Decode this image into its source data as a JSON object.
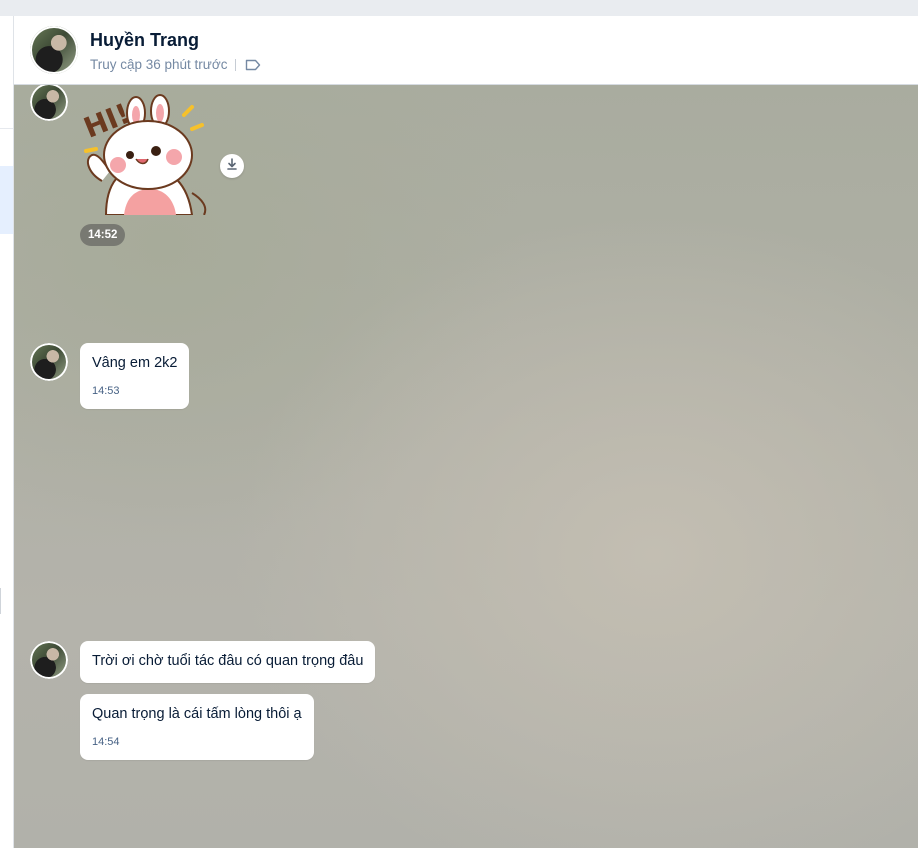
{
  "contact": {
    "name": "Huyền Trang",
    "status": "Truy cập 36 phút trước"
  },
  "messages": [
    {
      "type": "sticker",
      "alt": "HI!",
      "time": "14:52"
    },
    {
      "type": "text",
      "text": "Vâng em 2k2",
      "time": "14:53"
    },
    {
      "type": "text",
      "text": "Trời ơi chờ tuổi tác đâu có quan trọng đâu"
    },
    {
      "type": "text",
      "text": "Quan trọng là cái tấm lòng thôi ạ",
      "time": "14:54"
    }
  ],
  "icons": {
    "tag": "tag-icon",
    "download": "download-icon"
  },
  "colors": {
    "name": "#081c36",
    "status": "#7589a3",
    "bubble": "#ffffff",
    "time": "#476285"
  }
}
